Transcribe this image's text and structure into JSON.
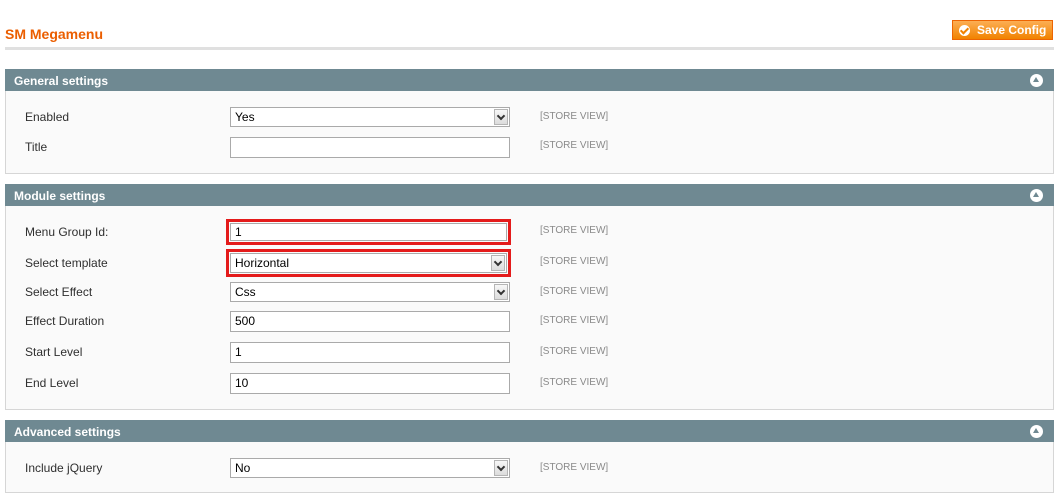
{
  "page": {
    "title": "SM Megamenu",
    "save_label": "Save Config"
  },
  "general": {
    "header": "General settings",
    "enabled": {
      "label": "Enabled",
      "value": "Yes",
      "scope": "[STORE VIEW]"
    },
    "title": {
      "label": "Title",
      "value": "",
      "scope": "[STORE VIEW]"
    }
  },
  "module": {
    "header": "Module settings",
    "menu_group_id": {
      "label": "Menu Group Id:",
      "value": "1",
      "scope": "[STORE VIEW]"
    },
    "select_template": {
      "label": "Select template",
      "value": "Horizontal",
      "scope": "[STORE VIEW]"
    },
    "select_effect": {
      "label": "Select Effect",
      "value": "Css",
      "scope": "[STORE VIEW]"
    },
    "effect_duration": {
      "label": "Effect Duration",
      "value": "500",
      "scope": "[STORE VIEW]"
    },
    "start_level": {
      "label": "Start Level",
      "value": "1",
      "scope": "[STORE VIEW]"
    },
    "end_level": {
      "label": "End Level",
      "value": "10",
      "scope": "[STORE VIEW]"
    }
  },
  "advanced": {
    "header": "Advanced settings",
    "include_jquery": {
      "label": "Include jQuery",
      "value": "No",
      "scope": "[STORE VIEW]"
    }
  },
  "colors": {
    "accent": "#eb5e00",
    "section_header": "#6f8992",
    "highlight": "#e41b1b",
    "button": "#f18200"
  },
  "icons": {
    "save": "check-circle-icon",
    "collapse": "collapse-up-icon",
    "dropdown": "chevron-down-icon"
  }
}
